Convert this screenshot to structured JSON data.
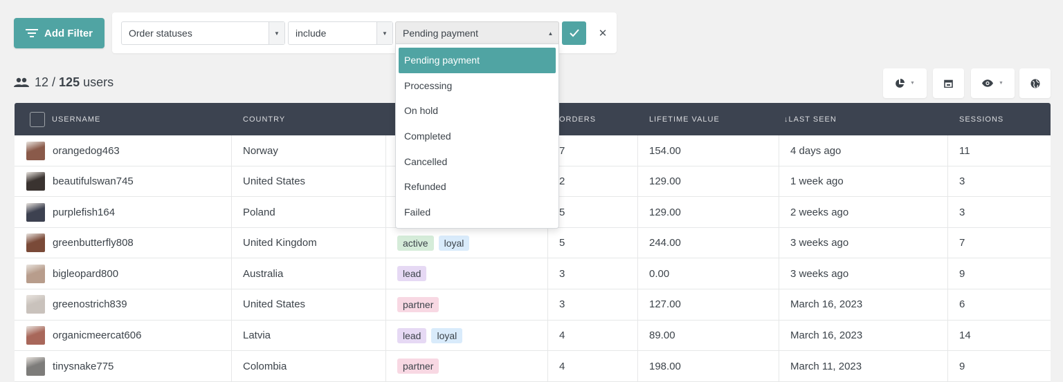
{
  "colors": {
    "accent": "#50a4a3",
    "header_bg": "#3c4350",
    "tag_active": "#d5ecd9",
    "tag_loyal": "#d9ebfb",
    "tag_lead": "#e6d9f4",
    "tag_partner": "#f8d8e3"
  },
  "toolbar": {
    "add_filter_label": "Add Filter",
    "add_filter_icon": "filter-list-icon"
  },
  "filter": {
    "field": "Order statuses",
    "operator": "include",
    "value": "Pending payment",
    "options": [
      "Pending payment",
      "Processing",
      "On hold",
      "Completed",
      "Cancelled",
      "Refunded",
      "Failed"
    ]
  },
  "summary": {
    "filtered": "12",
    "separator": "/",
    "total": "125",
    "unit": "users",
    "icon": "users-icon"
  },
  "tools": {
    "chart_icon": "pie-chart-icon",
    "calendar_icon": "calendar-icon",
    "eye_icon": "eye-icon",
    "globe_icon": "globe-icon"
  },
  "table": {
    "columns": {
      "username": "USERNAME",
      "country": "COUNTRY",
      "orders": "ORDERS",
      "lifetime_value": "LIFETIME VALUE",
      "last_seen": "LAST SEEN",
      "last_seen_sort": "↓",
      "sessions": "SESSIONS"
    },
    "rows": [
      {
        "username": "orangedog463",
        "avatar": "#8a5a4a",
        "country": "Norway",
        "tags": [],
        "orders": "7",
        "ltv": "154.00",
        "last_seen": "4 days ago",
        "sessions": "11"
      },
      {
        "username": "beautifulswan745",
        "avatar": "#3a3330",
        "country": "United States",
        "tags": [],
        "orders": "2",
        "ltv": "129.00",
        "last_seen": "1 week ago",
        "sessions": "3"
      },
      {
        "username": "purplefish164",
        "avatar": "#3d4150",
        "country": "Poland",
        "tags": [],
        "orders": "5",
        "ltv": "129.00",
        "last_seen": "2 weeks ago",
        "sessions": "3"
      },
      {
        "username": "greenbutterfly808",
        "avatar": "#7a4a38",
        "country": "United Kingdom",
        "tags": [
          {
            "label": "active",
            "kind": "active"
          },
          {
            "label": "loyal",
            "kind": "loyal"
          }
        ],
        "orders": "5",
        "ltv": "244.00",
        "last_seen": "3 weeks ago",
        "sessions": "7"
      },
      {
        "username": "bigleopard800",
        "avatar": "#b89d8c",
        "country": "Australia",
        "tags": [
          {
            "label": "lead",
            "kind": "lead"
          }
        ],
        "orders": "3",
        "ltv": "0.00",
        "last_seen": "3 weeks ago",
        "sessions": "9"
      },
      {
        "username": "greenostrich839",
        "avatar": "#c9c2bc",
        "country": "United States",
        "tags": [
          {
            "label": "partner",
            "kind": "partner"
          }
        ],
        "orders": "3",
        "ltv": "127.00",
        "last_seen": "March 16, 2023",
        "sessions": "6"
      },
      {
        "username": "organicmeercat606",
        "avatar": "#a8675a",
        "country": "Latvia",
        "tags": [
          {
            "label": "lead",
            "kind": "lead"
          },
          {
            "label": "loyal",
            "kind": "loyal"
          }
        ],
        "orders": "4",
        "ltv": "89.00",
        "last_seen": "March 16, 2023",
        "sessions": "14"
      },
      {
        "username": "tinysnake775",
        "avatar": "#7d7c7a",
        "country": "Colombia",
        "tags": [
          {
            "label": "partner",
            "kind": "partner"
          }
        ],
        "orders": "4",
        "ltv": "198.00",
        "last_seen": "March 11, 2023",
        "sessions": "9"
      }
    ]
  }
}
